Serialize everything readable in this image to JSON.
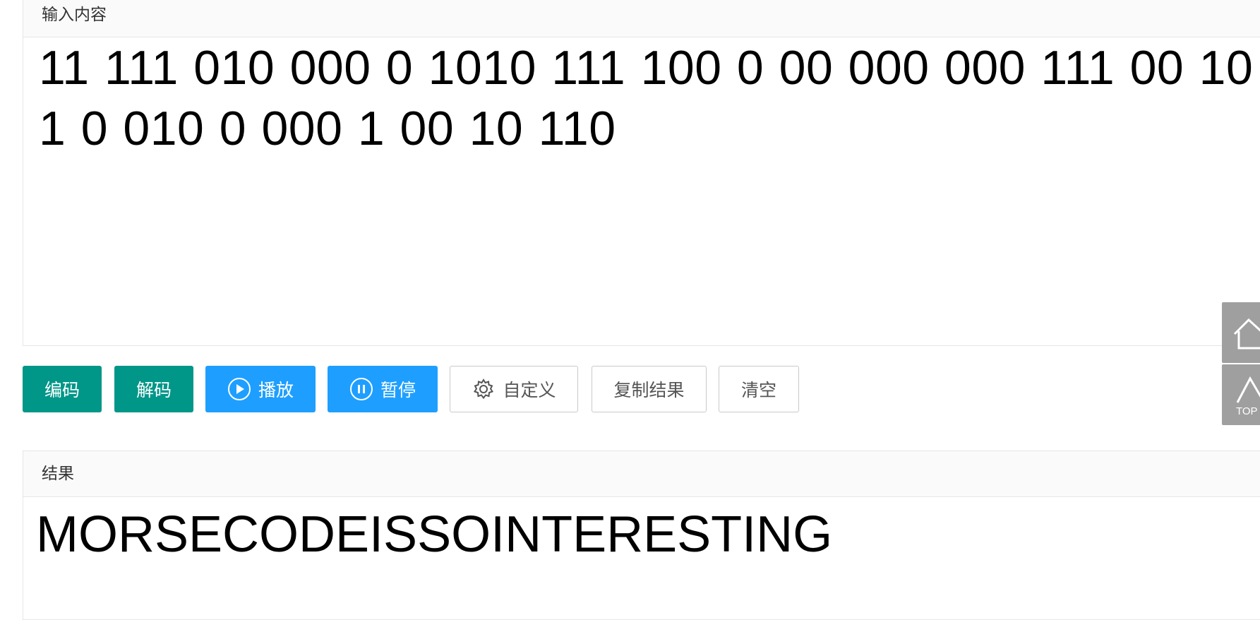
{
  "input_panel": {
    "title": "输入内容",
    "content": "11 111 010 000 0 1010 111 100 0 00 000 000 111 00 10 1 0 010 0 000 1 00 10 110"
  },
  "buttons": {
    "encode": "编码",
    "decode": "解码",
    "play": "播放",
    "pause": "暂停",
    "custom": "自定义",
    "copy": "复制结果",
    "clear": "清空"
  },
  "result_panel": {
    "title": "结果",
    "content": "MORSECODEISSOINTERESTING"
  },
  "side_tools": {
    "top_label": "TOP"
  },
  "colors": {
    "green": "#009688",
    "blue": "#1e9fff",
    "side": "#9f9f9f"
  }
}
